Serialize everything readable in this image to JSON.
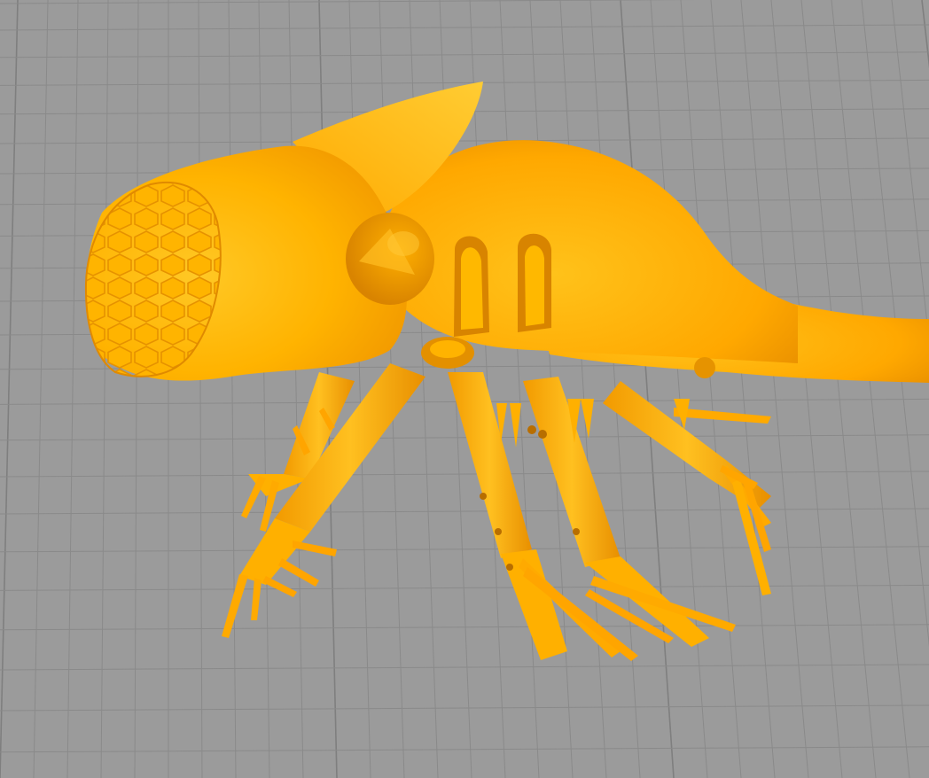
{
  "viewport": {
    "background_color": "#9b9b9b",
    "grid_line_color": "#8a8a8a",
    "grid_major_color": "#7f7f7f"
  },
  "model": {
    "color_highlight": "#ffc21a",
    "color_base": "#ffab00",
    "color_shadow": "#e08a00",
    "color_dark": "#c47400"
  }
}
